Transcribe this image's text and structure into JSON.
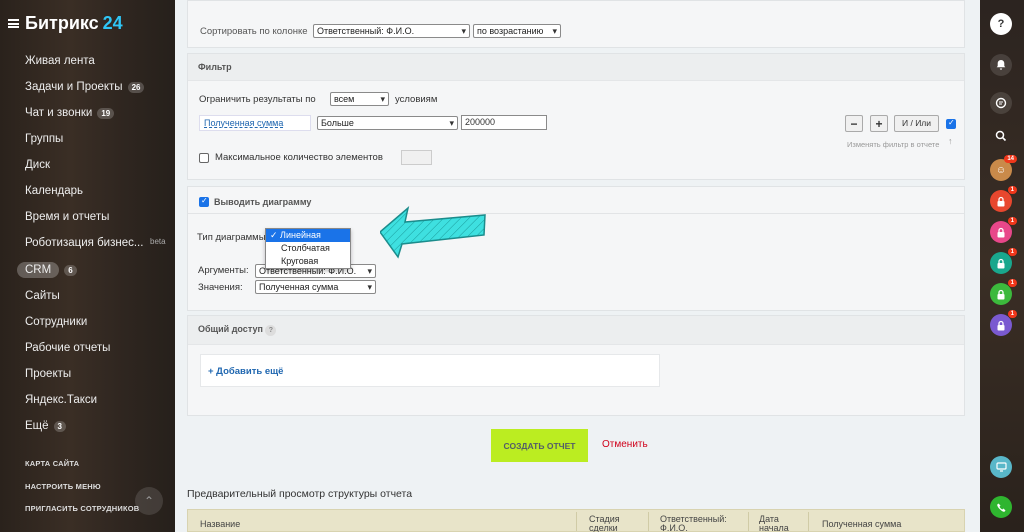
{
  "app": {
    "logo_text": "Битрикс",
    "logo_num": "24"
  },
  "sidebar": {
    "items": [
      {
        "label": "Живая лента"
      },
      {
        "label": "Задачи и Проекты",
        "count": "26"
      },
      {
        "label": "Чат и звонки",
        "count": "19"
      },
      {
        "label": "Группы"
      },
      {
        "label": "Диск"
      },
      {
        "label": "Календарь"
      },
      {
        "label": "Время и отчеты"
      },
      {
        "label": "Роботизация бизнес..."
      },
      {
        "label": "CRM",
        "count": "6"
      },
      {
        "label": "Сайты"
      },
      {
        "label": "Сотрудники"
      },
      {
        "label": "Рабочие отчеты"
      },
      {
        "label": "Проекты"
      },
      {
        "label": "Яндекс.Такси"
      },
      {
        "label": "Ещё",
        "count": "3"
      }
    ],
    "beta": "beta",
    "footer": [
      "КАРТА САЙТА",
      "НАСТРОИТЬ МЕНЮ",
      "ПРИГЛАСИТЬ СОТРУДНИКОВ"
    ]
  },
  "sort": {
    "label": "Сортировать по колонке",
    "column_value": "Ответственный: Ф.И.О.",
    "order_value": "по возрастанию"
  },
  "filter": {
    "title": "Фильтр",
    "limit_label": "Ограничить результаты по",
    "limit_value": "всем",
    "conditions_label": "условиям",
    "field_name": "Полученная сумма",
    "operator_value": "Больше",
    "amount_value": "200000",
    "minus": "−",
    "plus": "+",
    "andor": "И / Или",
    "max_label": "Максимальное количество элементов",
    "change_in_report": "Изменять фильтр в отчете"
  },
  "chart": {
    "show_label": "Выводить диаграмму",
    "type_label": "Тип диаграммы",
    "type_options": [
      "Линейная",
      "Столбчатая",
      "Круговая"
    ],
    "type_selected": "Линейная",
    "args_label": "Аргументы:",
    "args_value": "Ответственный: Ф.И.О.",
    "values_label": "Значения:",
    "values_value": "Полученная сумма"
  },
  "access": {
    "title": "Общий доступ",
    "help": "?",
    "add_more": "+ Добавить ещё"
  },
  "actions": {
    "create": "СОЗДАТЬ ОТЧЕТ",
    "cancel": "Отменить"
  },
  "preview": {
    "title": "Предварительный просмотр структуры отчета",
    "columns": [
      "Название",
      "Стадия сделки",
      "Ответственный: Ф.И.О.",
      "Дата начала",
      "Полученная сумма"
    ]
  },
  "rightbar": {
    "help": "?",
    "avatar_badge": "14",
    "lock_badge": "1"
  },
  "colors": {
    "accent": "#bbed21",
    "link": "#2067b0",
    "cancel": "#d0021b",
    "arrow": "#3ee0e0"
  }
}
